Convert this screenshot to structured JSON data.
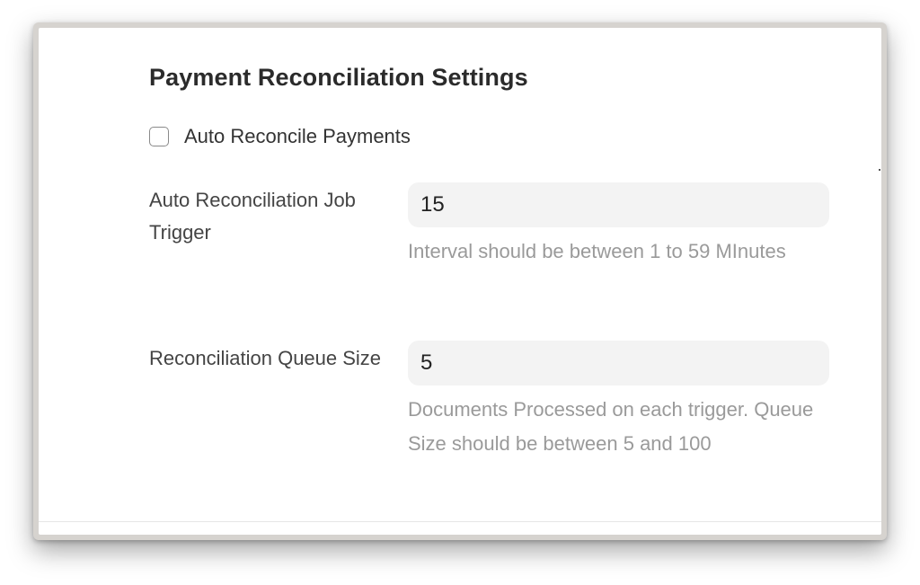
{
  "settings": {
    "title": "Payment Reconciliation Settings",
    "auto_reconcile": {
      "label": "Auto Reconcile Payments",
      "checked": false
    },
    "job_trigger": {
      "label": "Auto Reconciliation Job Trigger",
      "value": "15",
      "help": "Interval should be between 1 to 59 MInutes"
    },
    "queue_size": {
      "label": "Reconciliation Queue Size",
      "value": "5",
      "help": "Documents Processed on each trigger. Queue Size should be between 5 and 100"
    }
  }
}
